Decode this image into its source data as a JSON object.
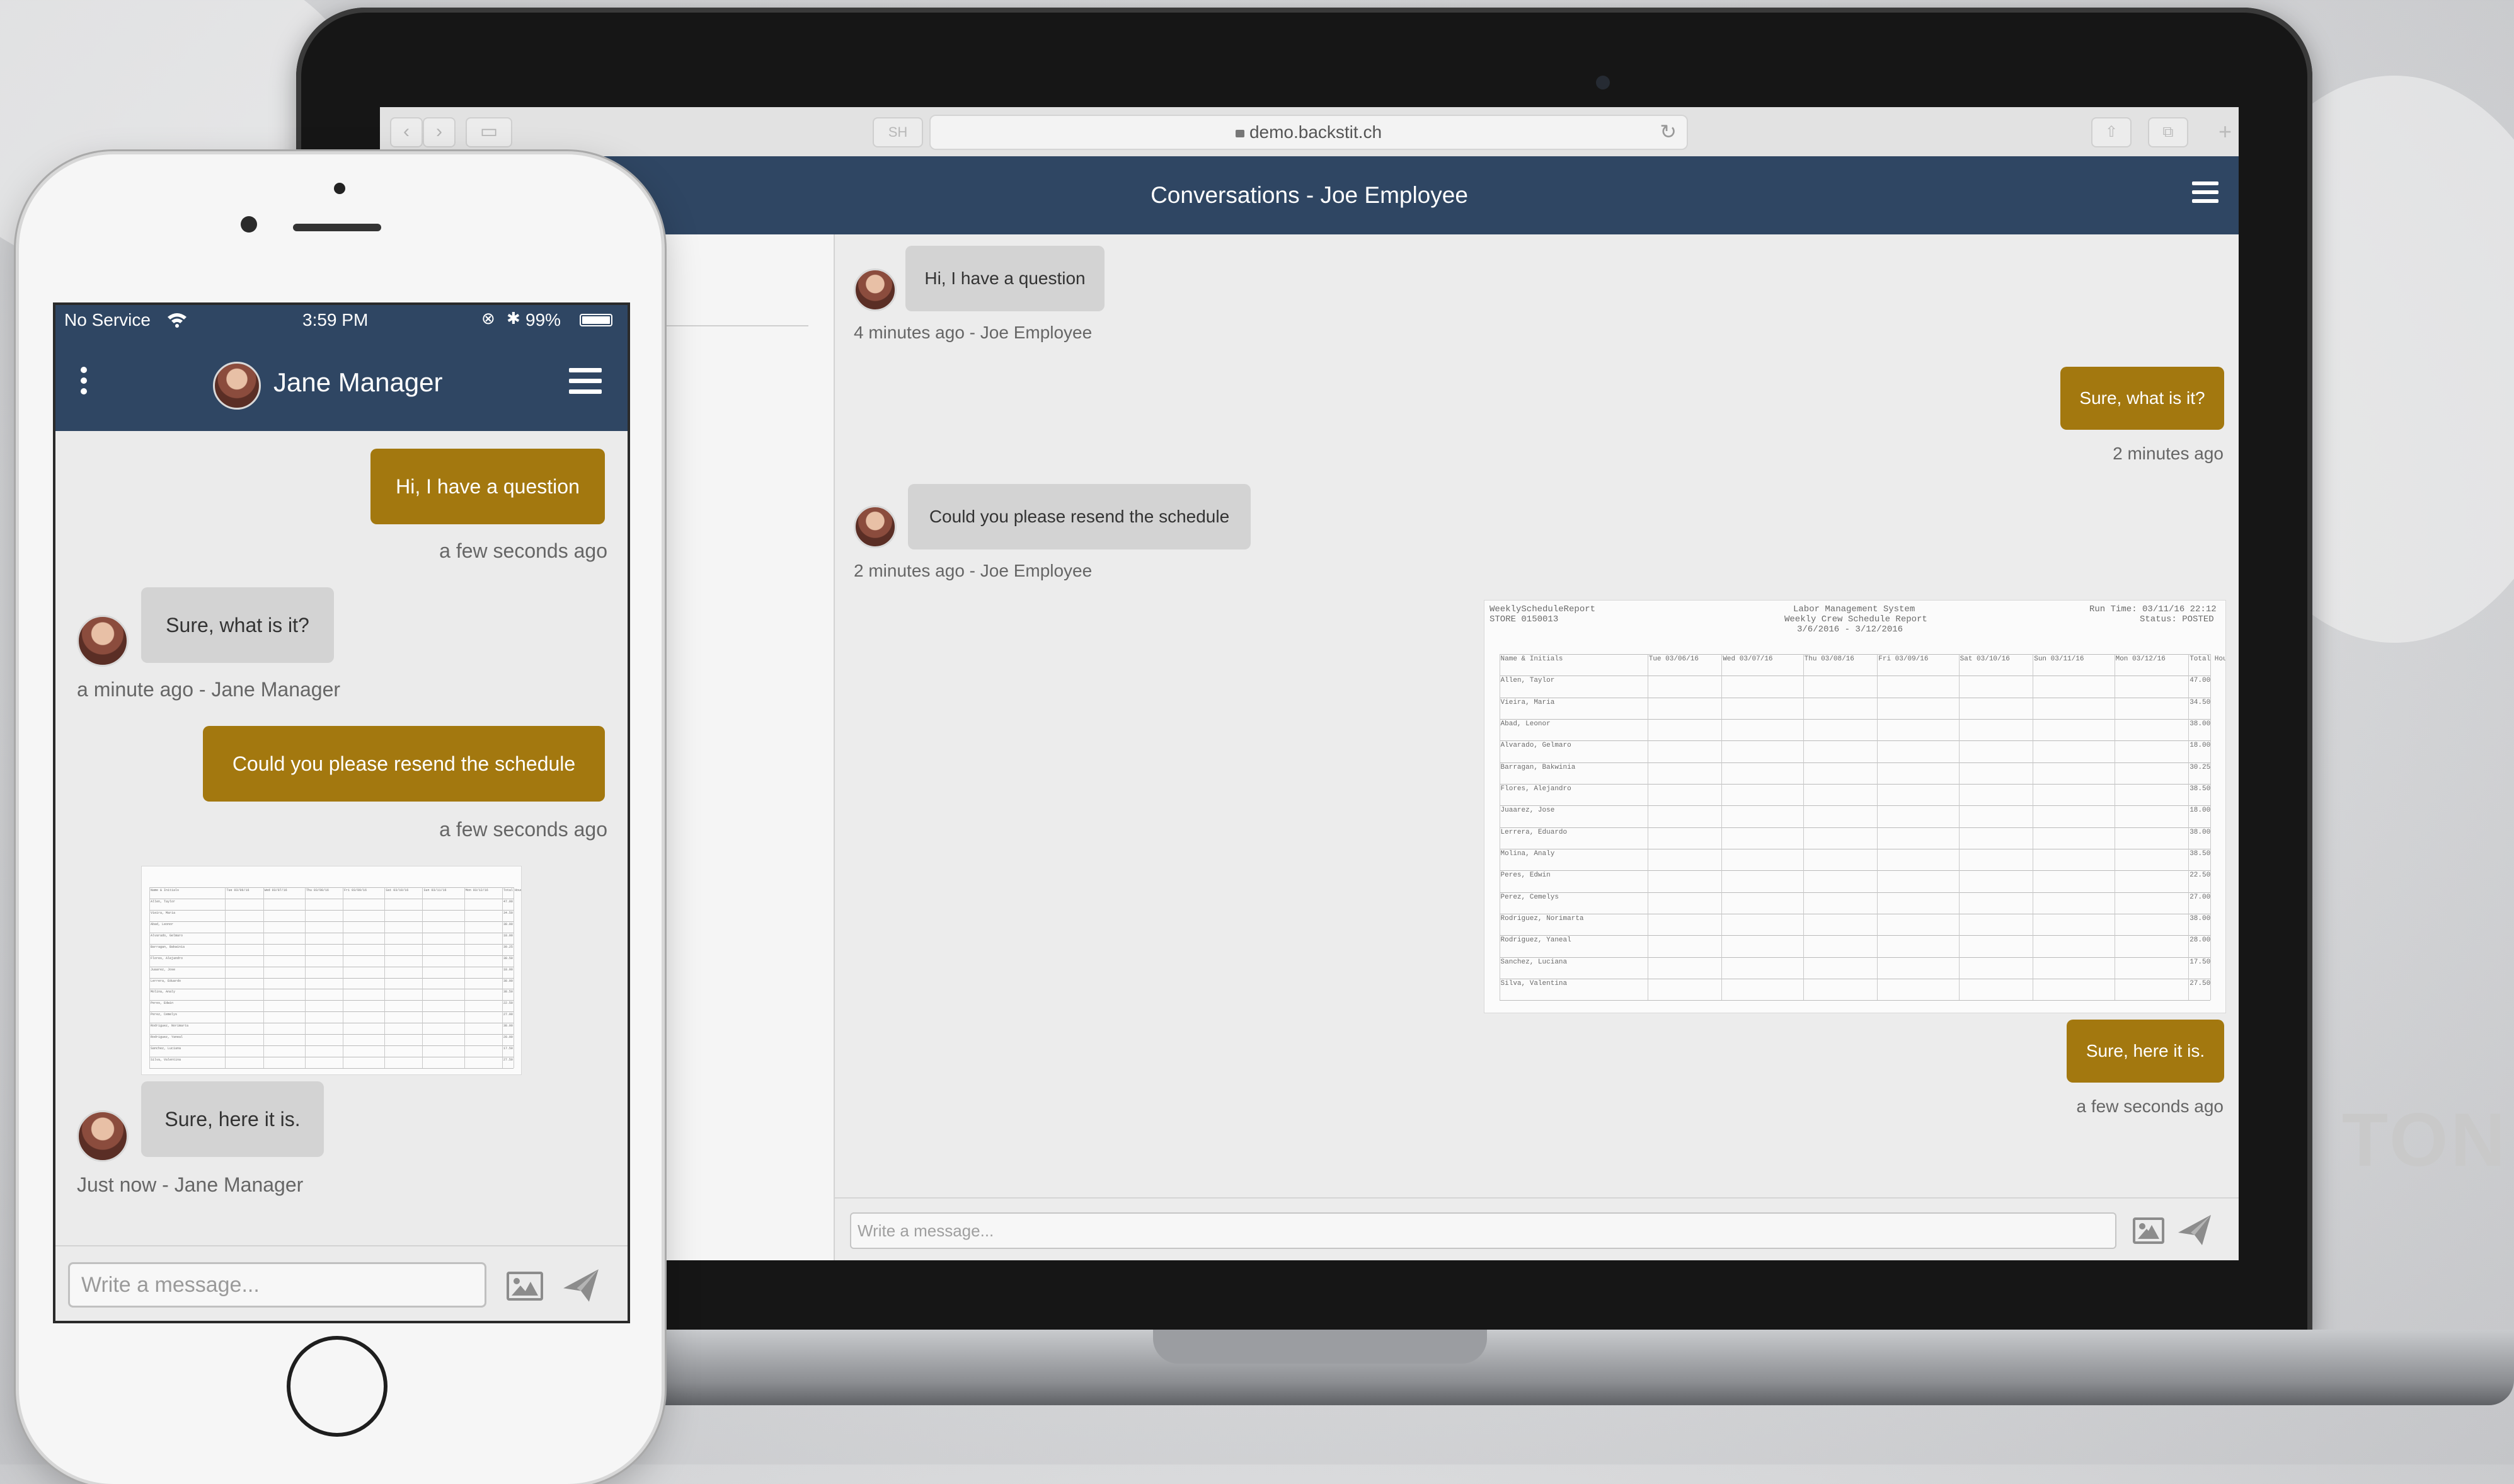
{
  "colors": {
    "header": "#2f4663",
    "outgoing_bubble": "#a3780f",
    "incoming_bubble": "#d3d3d3"
  },
  "background": {
    "watermark_text": "TON"
  },
  "browser": {
    "tab_badge": "SH",
    "url": "demo.backstit.ch",
    "page_title": "Conversations - Joe Employee",
    "messages": [
      {
        "direction": "in",
        "text": "Hi, I have a question",
        "meta": "4 minutes ago - Joe Employee"
      },
      {
        "direction": "out",
        "text": "Sure, what is it?",
        "meta": "2 minutes ago"
      },
      {
        "direction": "in",
        "text": "Could you please resend the schedule",
        "meta": "2 minutes ago - Joe Employee"
      },
      {
        "direction": "out",
        "text": "Sure, here it is.",
        "meta": "a few seconds ago"
      }
    ],
    "input_placeholder": "Write a message..."
  },
  "phone": {
    "status": {
      "carrier": "No Service",
      "time": "3:59 PM",
      "battery": "99%"
    },
    "contact_name": "Jane Manager",
    "messages": [
      {
        "direction": "out",
        "text": "Hi, I have a question",
        "meta": "a few seconds ago"
      },
      {
        "direction": "in",
        "text": "Sure, what is it?",
        "meta": "a minute ago - Jane Manager"
      },
      {
        "direction": "out",
        "text": "Could you please resend the schedule",
        "meta": "a few seconds ago"
      },
      {
        "direction": "in",
        "text": "Sure, here it is.",
        "meta": "Just now - Jane Manager"
      }
    ],
    "input_placeholder": "Write a message..."
  },
  "schedule_attachment": {
    "report_name": "WeeklyScheduleReport",
    "store": "STORE 0150013",
    "system": "Labor Management System",
    "subtitle": "Weekly Crew Schedule Report",
    "date_range": "3/6/2016 - 3/12/2016",
    "run_time": "Run Time: 03/11/16 22:12",
    "status": "Status: POSTED",
    "headers": [
      "Name & Initials",
      "Tue 03/06/16",
      "Wed 03/07/16",
      "Thu 03/08/16",
      "Fri 03/09/16",
      "Sat 03/10/16",
      "Sun 03/11/16",
      "Mon 03/12/16",
      "Total Hours"
    ],
    "rows": [
      [
        "Allen, Taylor",
        "47.00"
      ],
      [
        "Vieira, Maria",
        "34.50"
      ],
      [
        "Abad, Leonor",
        "38.00"
      ],
      [
        "Alvarado, Gelmaro",
        "18.00"
      ],
      [
        "Barragan, Bakwinia",
        "30.25"
      ],
      [
        "Flores, Alejandro",
        "38.50"
      ],
      [
        "Juaarez, Jose",
        "18.00"
      ],
      [
        "Lerrera, Eduardo",
        "38.00"
      ],
      [
        "Molina, Analy",
        "38.50"
      ],
      [
        "Peres, Edwin",
        "22.50"
      ],
      [
        "Perez, Cemelys",
        "27.00"
      ],
      [
        "Rodriguez, Norimarta",
        "38.00"
      ],
      [
        "Rodriguez, Yaneal",
        "28.00"
      ],
      [
        "Sanchez, Luciana",
        "17.50"
      ],
      [
        "Silva, Valentina",
        "27.50"
      ]
    ]
  }
}
